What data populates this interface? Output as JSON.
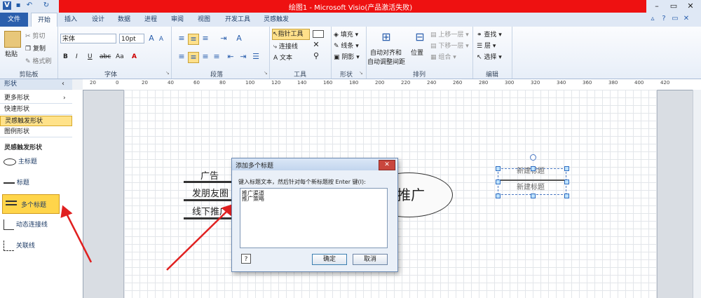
{
  "title_bar": {
    "title": "绘图1 - Microsoft Visio(产品激活失败)",
    "quick_access": [
      "visio-app-icon",
      "save-icon",
      "undo-icon",
      "redo-icon"
    ],
    "window_controls": [
      "minimize-icon",
      "maximize-icon",
      "close-icon"
    ]
  },
  "tabs": [
    "文件",
    "开始",
    "插入",
    "设计",
    "数据",
    "进程",
    "审阅",
    "视图",
    "开发工具",
    "灵感触发"
  ],
  "ribbon": {
    "clipboard": {
      "label": "剪贴板",
      "paste": "粘贴",
      "cut": "剪切",
      "copy": "复制",
      "format_painter": "格式刷"
    },
    "font": {
      "label": "字体",
      "font_name": "宋体",
      "font_size": "10pt",
      "bold": "B",
      "italic": "I",
      "underline": "U",
      "strike": "abc",
      "case": "Aa",
      "color": "A"
    },
    "paragraph": {
      "label": "段落"
    },
    "tools": {
      "label": "工具",
      "pointer": "指针工具",
      "connector": "连接线",
      "text": "文本"
    },
    "shape": {
      "label": "形状",
      "fill": "填充",
      "line": "线条",
      "shadow": "阴影"
    },
    "arrange": {
      "label": "排列",
      "auto_align": "自动对齐和",
      "auto_space": "自动调整间距",
      "position": "位置",
      "bring_forward": "上移一层",
      "send_backward": "下移一层",
      "group": "组合"
    },
    "editing": {
      "label": "编辑",
      "find": "查找",
      "layers": "层",
      "select": "选择"
    }
  },
  "left_pane": {
    "header": "形状",
    "collapse": "‹",
    "sections": [
      "更多形状",
      "快速形状",
      "灵感触发形状",
      "图例形状"
    ],
    "stencil_title": "灵感触发形状",
    "stencil_items": [
      "主标题",
      "标题",
      "多个标题",
      "动态连接线",
      "关联线"
    ]
  },
  "ruler_labels": [
    "20",
    "0",
    "20",
    "40",
    "60",
    "80",
    "100",
    "120",
    "140",
    "160",
    "180",
    "200",
    "220",
    "240",
    "260",
    "280",
    "300",
    "320",
    "340",
    "360",
    "380",
    "400",
    "420"
  ],
  "canvas": {
    "bullets": [
      "广告",
      "发朋友圈",
      "线下推广"
    ],
    "ellipse_text": "推广",
    "new_titles": [
      "新建标题",
      "新建标题"
    ]
  },
  "dialog": {
    "title": "添加多个标题",
    "instruction": "键入标题文本，然后针对每个新标题按 Enter 键(I):",
    "lines": [
      "推广渠道",
      "推广策略"
    ],
    "ok": "确定",
    "cancel": "取消"
  },
  "colors": {
    "title_highlight": "#ee1111",
    "accent": "#2b5fad",
    "selected_item": "#ffd54a",
    "arrow": "#e02020"
  }
}
